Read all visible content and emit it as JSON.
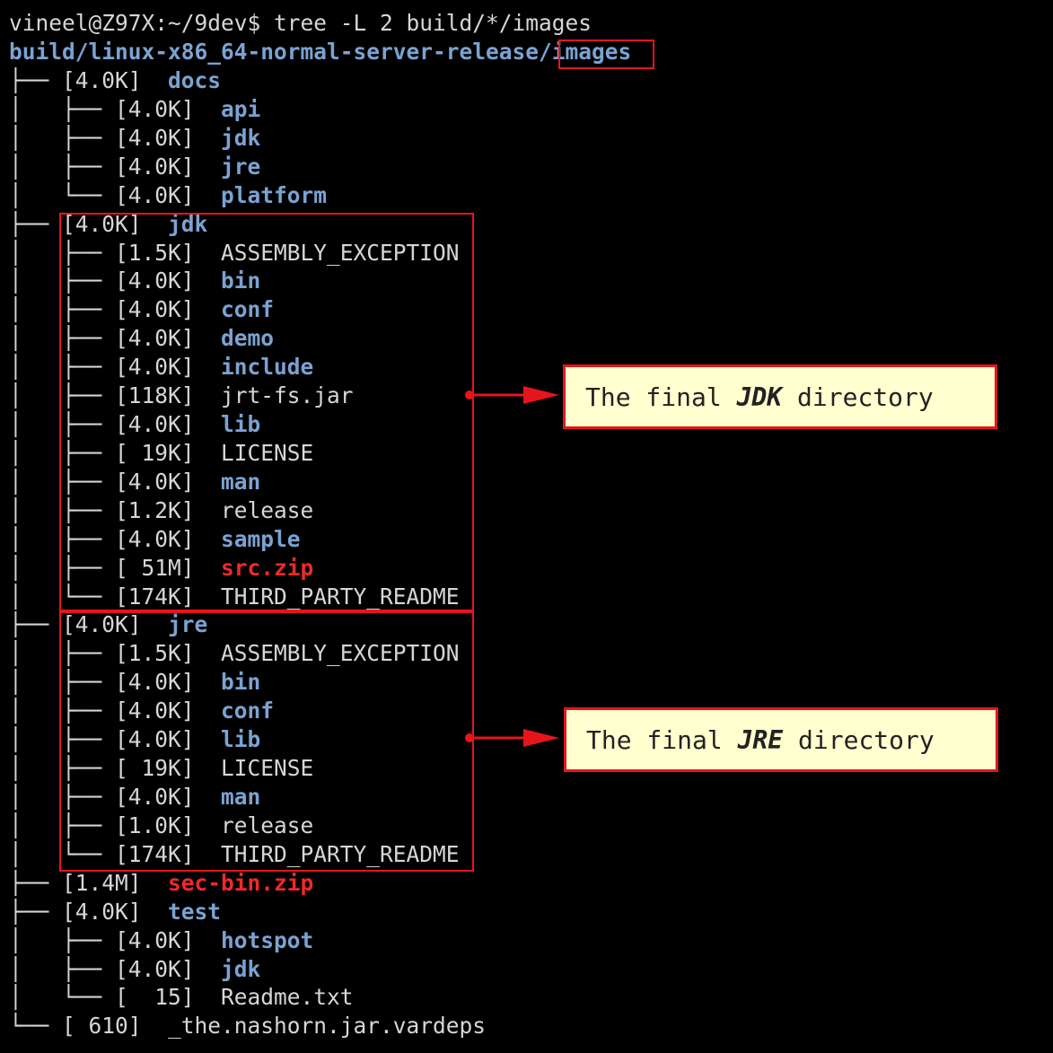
{
  "terminal": {
    "prompt_line": "vineel@Z97X:~/9dev$ tree -L 2 build/*/images",
    "root_path_prefix": "build/linux-x86_64-normal-server-release/",
    "root_path_highlight": "images"
  },
  "tree": [
    {
      "prefix": "├── ",
      "size": "[4.0K]",
      "name": "docs",
      "kind": "dir"
    },
    {
      "prefix": "│   ├── ",
      "size": "[4.0K]",
      "name": "api",
      "kind": "dir"
    },
    {
      "prefix": "│   ├── ",
      "size": "[4.0K]",
      "name": "jdk",
      "kind": "dir"
    },
    {
      "prefix": "│   ├── ",
      "size": "[4.0K]",
      "name": "jre",
      "kind": "dir"
    },
    {
      "prefix": "│   └── ",
      "size": "[4.0K]",
      "name": "platform",
      "kind": "dir"
    },
    {
      "prefix": "├── ",
      "size": "[4.0K]",
      "name": "jdk",
      "kind": "dir"
    },
    {
      "prefix": "│   ├── ",
      "size": "[1.5K]",
      "name": "ASSEMBLY_EXCEPTION",
      "kind": "file"
    },
    {
      "prefix": "│   ├── ",
      "size": "[4.0K]",
      "name": "bin",
      "kind": "dir"
    },
    {
      "prefix": "│   ├── ",
      "size": "[4.0K]",
      "name": "conf",
      "kind": "dir"
    },
    {
      "prefix": "│   ├── ",
      "size": "[4.0K]",
      "name": "demo",
      "kind": "dir"
    },
    {
      "prefix": "│   ├── ",
      "size": "[4.0K]",
      "name": "include",
      "kind": "dir"
    },
    {
      "prefix": "│   ├── ",
      "size": "[118K]",
      "name": "jrt-fs.jar",
      "kind": "file"
    },
    {
      "prefix": "│   ├── ",
      "size": "[4.0K]",
      "name": "lib",
      "kind": "dir"
    },
    {
      "prefix": "│   ├── ",
      "size": "[ 19K]",
      "name": "LICENSE",
      "kind": "file"
    },
    {
      "prefix": "│   ├── ",
      "size": "[4.0K]",
      "name": "man",
      "kind": "dir"
    },
    {
      "prefix": "│   ├── ",
      "size": "[1.2K]",
      "name": "release",
      "kind": "file"
    },
    {
      "prefix": "│   ├── ",
      "size": "[4.0K]",
      "name": "sample",
      "kind": "dir"
    },
    {
      "prefix": "│   ├── ",
      "size": "[ 51M]",
      "name": "src.zip",
      "kind": "archive"
    },
    {
      "prefix": "│   └── ",
      "size": "[174K]",
      "name": "THIRD_PARTY_README",
      "kind": "file"
    },
    {
      "prefix": "├── ",
      "size": "[4.0K]",
      "name": "jre",
      "kind": "dir"
    },
    {
      "prefix": "│   ├── ",
      "size": "[1.5K]",
      "name": "ASSEMBLY_EXCEPTION",
      "kind": "file"
    },
    {
      "prefix": "│   ├── ",
      "size": "[4.0K]",
      "name": "bin",
      "kind": "dir"
    },
    {
      "prefix": "│   ├── ",
      "size": "[4.0K]",
      "name": "conf",
      "kind": "dir"
    },
    {
      "prefix": "│   ├── ",
      "size": "[4.0K]",
      "name": "lib",
      "kind": "dir"
    },
    {
      "prefix": "│   ├── ",
      "size": "[ 19K]",
      "name": "LICENSE",
      "kind": "file"
    },
    {
      "prefix": "│   ├── ",
      "size": "[4.0K]",
      "name": "man",
      "kind": "dir"
    },
    {
      "prefix": "│   ├── ",
      "size": "[1.0K]",
      "name": "release",
      "kind": "file"
    },
    {
      "prefix": "│   └── ",
      "size": "[174K]",
      "name": "THIRD_PARTY_README",
      "kind": "file"
    },
    {
      "prefix": "├── ",
      "size": "[1.4M]",
      "name": "sec-bin.zip",
      "kind": "archive"
    },
    {
      "prefix": "├── ",
      "size": "[4.0K]",
      "name": "test",
      "kind": "dir"
    },
    {
      "prefix": "│   ├── ",
      "size": "[4.0K]",
      "name": "hotspot",
      "kind": "dir"
    },
    {
      "prefix": "│   ├── ",
      "size": "[4.0K]",
      "name": "jdk",
      "kind": "dir"
    },
    {
      "prefix": "│   └── ",
      "size": "[  15]",
      "name": "Readme.txt",
      "kind": "file"
    },
    {
      "prefix": "└── ",
      "size": "[ 610]",
      "name": "_the.nashorn.jar.vardeps",
      "kind": "file"
    }
  ],
  "callouts": {
    "jdk": {
      "before": "The final ",
      "emph": "JDK",
      "after": " directory"
    },
    "jre": {
      "before": "The final ",
      "emph": "JRE",
      "after": " directory"
    }
  },
  "colors": {
    "background": "#000000",
    "text": "#d6d6d6",
    "directory": "#7aa3d2",
    "archive": "#ef2929",
    "highlight": "#e8141c",
    "callout_bg": "#ffffcf"
  }
}
